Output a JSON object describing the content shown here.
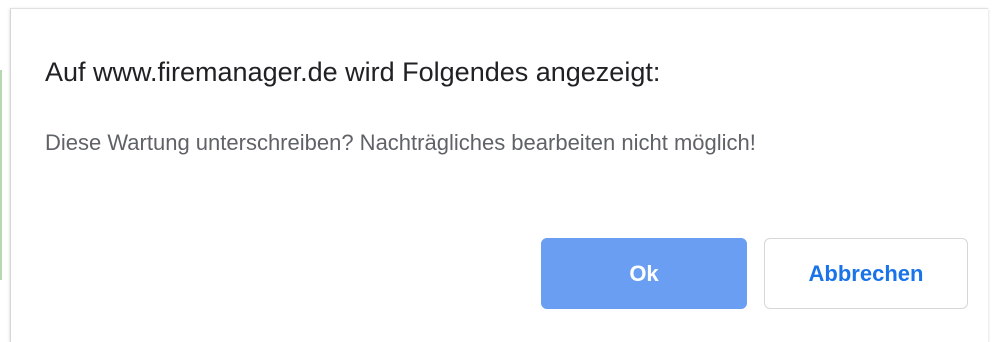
{
  "dialog": {
    "title": "Auf www.firemanager.de wird Folgendes angezeigt:",
    "message": "Diese Wartung unterschreiben? Nachträgliches bearbeiten nicht möglich!",
    "buttons": {
      "ok_label": "Ok",
      "cancel_label": "Abbrechen"
    }
  },
  "colors": {
    "ok_button_background": "#6a9ef2",
    "cancel_button_text": "#1a73e8",
    "title_text": "#202124",
    "message_text": "#5f6368"
  }
}
